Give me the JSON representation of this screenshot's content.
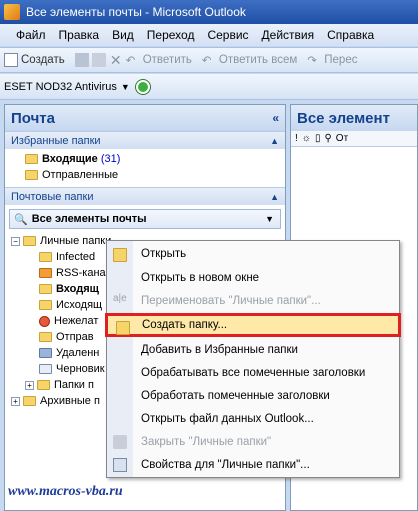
{
  "window": {
    "title": "Все элементы почты - Microsoft Outlook"
  },
  "menu": [
    "Файл",
    "Правка",
    "Вид",
    "Переход",
    "Сервис",
    "Действия",
    "Справка"
  ],
  "toolbar": {
    "create": "Создать",
    "reply": "Ответить",
    "reply_all": "Ответить всем",
    "forward": "Перес"
  },
  "toolbar2": {
    "antivirus": "ESET NOD32 Antivirus"
  },
  "nav": {
    "title": "Почта",
    "collapse": "«",
    "favorites_header": "Избранные папки",
    "favorites": [
      {
        "label": "Входящие",
        "count": "(31)",
        "bold": true
      },
      {
        "label": "Отправленные",
        "count": "",
        "bold": false
      }
    ],
    "mail_folders_header": "Почтовые папки",
    "dropdown_label": "Все элементы почты",
    "tree": [
      {
        "label": "Личные папки",
        "level": 0,
        "bold": false
      },
      {
        "label": "Infected",
        "level": 1,
        "bold": false
      },
      {
        "label": "RSS-кана",
        "level": 1,
        "bold": false
      },
      {
        "label": "Входящ",
        "level": 1,
        "bold": true
      },
      {
        "label": "Исходящ",
        "level": 1,
        "bold": false
      },
      {
        "label": "Нежелат",
        "level": 1,
        "bold": false
      },
      {
        "label": "Отправ",
        "level": 1,
        "bold": false
      },
      {
        "label": "Удаленн",
        "level": 1,
        "bold": false
      },
      {
        "label": "Черновик",
        "level": 1,
        "bold": false
      },
      {
        "label": "Папки п",
        "level": 1,
        "bold": false
      },
      {
        "label": "Архивные п",
        "level": 0,
        "bold": false
      }
    ]
  },
  "view": {
    "title": "Все элемент",
    "col_from": "От"
  },
  "context_menu": [
    {
      "label": "Открыть",
      "dim": false,
      "hl": false,
      "icon": "open-folder-icon"
    },
    {
      "label": "Открыть в новом окне",
      "dim": false,
      "hl": false,
      "icon": ""
    },
    {
      "label": "Переименовать \"Личные папки\"...",
      "dim": true,
      "hl": false,
      "icon": "rename-icon"
    },
    {
      "label": "Создать папку...",
      "dim": false,
      "hl": true,
      "icon": "new-folder-icon"
    },
    {
      "label": "Добавить в Избранные папки",
      "dim": false,
      "hl": false,
      "icon": ""
    },
    {
      "label": "Обрабатывать все помеченные заголовки",
      "dim": false,
      "hl": false,
      "icon": ""
    },
    {
      "label": "Обработать помеченные заголовки",
      "dim": false,
      "hl": false,
      "icon": ""
    },
    {
      "label": "Открыть файл данных Outlook...",
      "dim": false,
      "hl": false,
      "icon": ""
    },
    {
      "label": "Закрыть \"Личные папки\"",
      "dim": true,
      "hl": false,
      "icon": "close-folder-icon"
    },
    {
      "label": "Свойства для \"Личные папки\"...",
      "dim": false,
      "hl": false,
      "icon": "properties-icon"
    }
  ],
  "watermark": "www.macros-vba.ru",
  "colors": {
    "title_bar": "#1f4fa6",
    "highlight_border": "#e02020",
    "highlight_fill": "#ffe9a8",
    "header_text": "#15428b"
  }
}
